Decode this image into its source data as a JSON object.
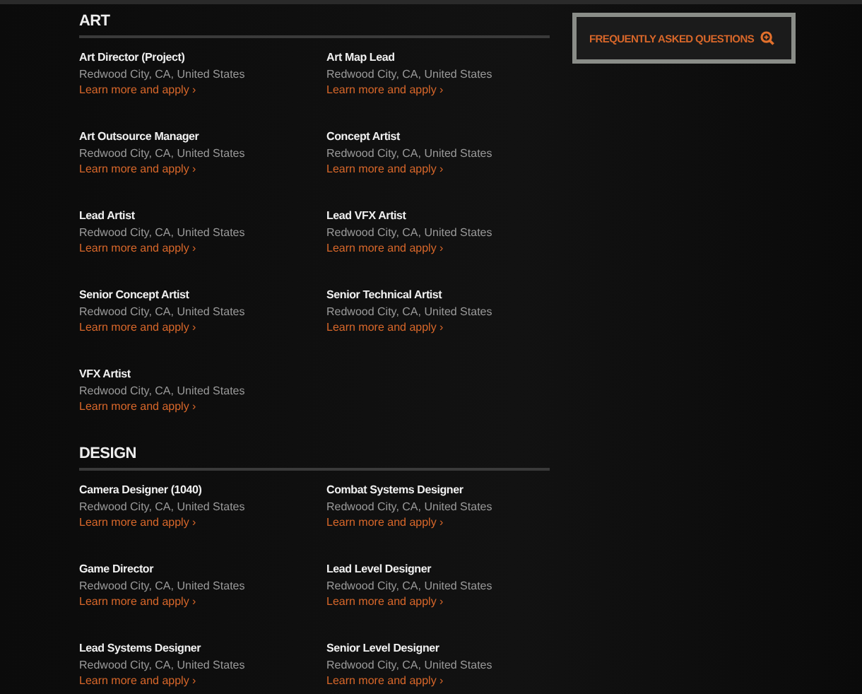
{
  "sections": [
    {
      "title": "ART",
      "jobs": [
        {
          "title": "Art Director (Project)",
          "location": "Redwood City, CA, United States",
          "link": "Learn more and apply ›"
        },
        {
          "title": "Art Map Lead",
          "location": "Redwood City, CA, United States",
          "link": "Learn more and apply ›"
        },
        {
          "title": "Art Outsource Manager",
          "location": "Redwood City, CA, United States",
          "link": "Learn more and apply ›"
        },
        {
          "title": "Concept Artist",
          "location": "Redwood City, CA, United States",
          "link": "Learn more and apply ›"
        },
        {
          "title": "Lead Artist",
          "location": "Redwood City, CA, United States",
          "link": "Learn more and apply ›"
        },
        {
          "title": "Lead VFX Artist",
          "location": "Redwood City, CA, United States",
          "link": "Learn more and apply ›"
        },
        {
          "title": "Senior Concept Artist",
          "location": "Redwood City, CA, United States",
          "link": "Learn more and apply ›"
        },
        {
          "title": "Senior Technical Artist",
          "location": "Redwood City, CA, United States",
          "link": "Learn more and apply ›"
        },
        {
          "title": "VFX Artist",
          "location": "Redwood City, CA, United States",
          "link": "Learn more and apply ›"
        }
      ]
    },
    {
      "title": "DESIGN",
      "jobs": [
        {
          "title": "Camera Designer (1040)",
          "location": "Redwood City, CA, United States",
          "link": "Learn more and apply ›"
        },
        {
          "title": "Combat Systems Designer",
          "location": "Redwood City, CA, United States",
          "link": "Learn more and apply ›"
        },
        {
          "title": "Game Director",
          "location": "Redwood City, CA, United States",
          "link": "Learn more and apply ›"
        },
        {
          "title": "Lead Level Designer",
          "location": "Redwood City, CA, United States",
          "link": "Learn more and apply ›"
        },
        {
          "title": "Lead Systems Designer",
          "location": "Redwood City, CA, United States",
          "link": "Learn more and apply ›"
        },
        {
          "title": "Senior Level Designer",
          "location": "Redwood City, CA, United States",
          "link": "Learn more and apply ›"
        }
      ]
    }
  ],
  "faq_button": {
    "label": "FREQUENTLY ASKED QUESTIONS"
  }
}
